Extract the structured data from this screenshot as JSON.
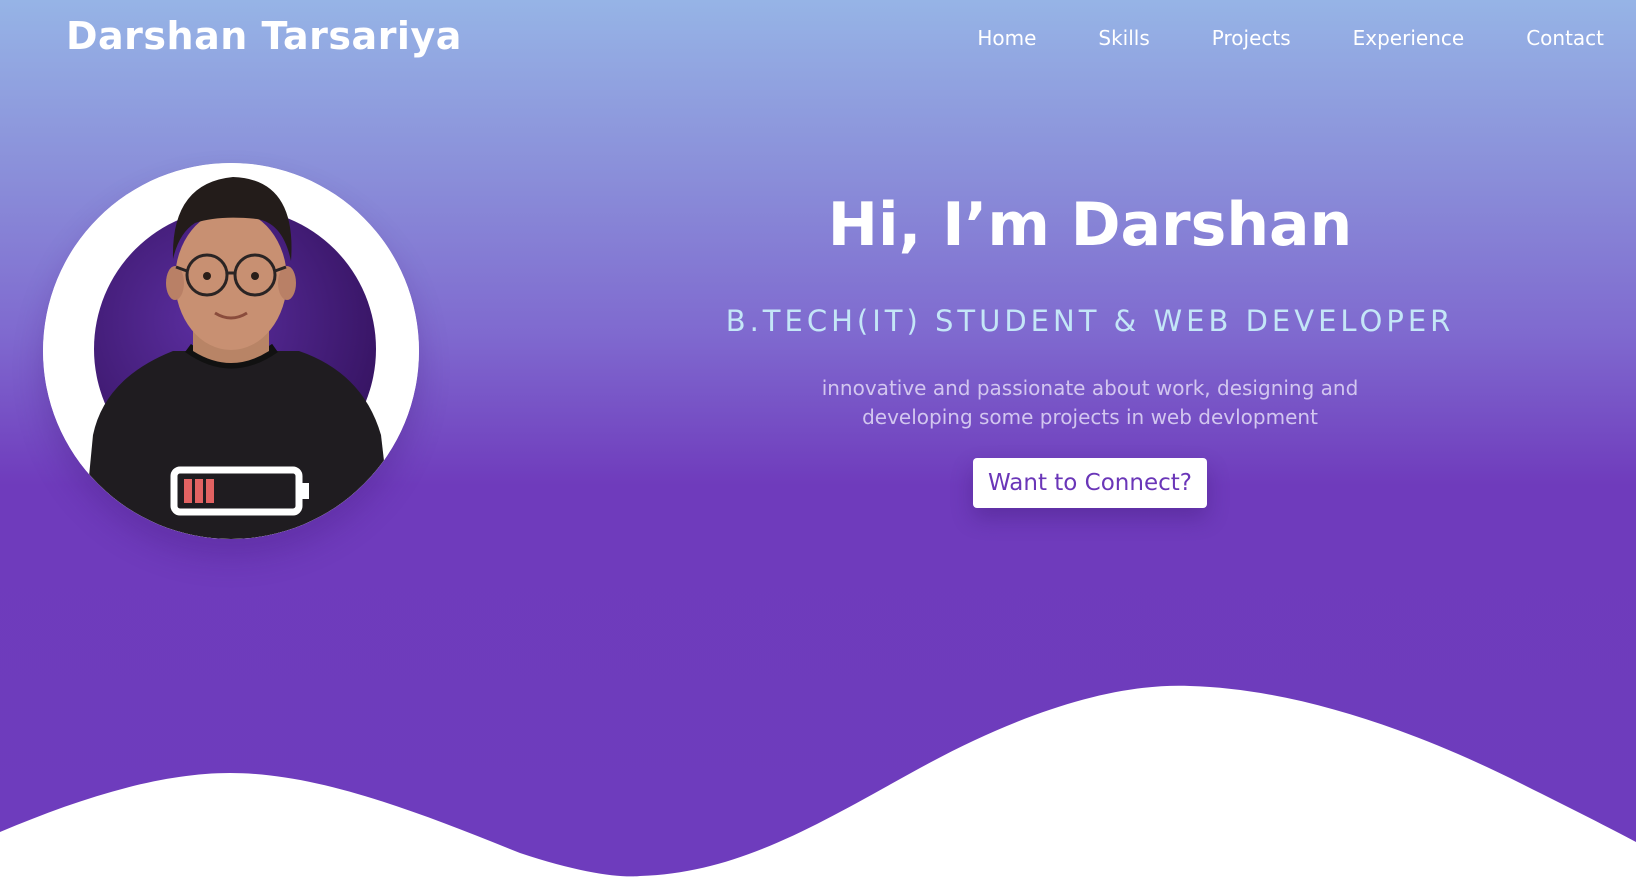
{
  "header": {
    "brand": "Darshan Tarsariya",
    "nav": [
      "Home",
      "Skills",
      "Projects",
      "Experience",
      "Contact"
    ]
  },
  "hero": {
    "greeting": "Hi, I’m Darshan",
    "role": "B.TECH(IT) STUDENT & WEB DEVELOPER",
    "description": "innovative and passionate about work, designing and developing some projects in web devlopment",
    "cta_label": "Want to Connect?"
  },
  "profile_photo": {
    "icon": "profile-photo-icon",
    "tshirt_graphic": "battery-low-icon"
  },
  "colors": {
    "gradient_top": "#96b4e6",
    "gradient_bottom": "#6e3cbd",
    "accent": "#6a36b8",
    "role_text": "#c4e6f7",
    "wave": "#ffffff"
  }
}
